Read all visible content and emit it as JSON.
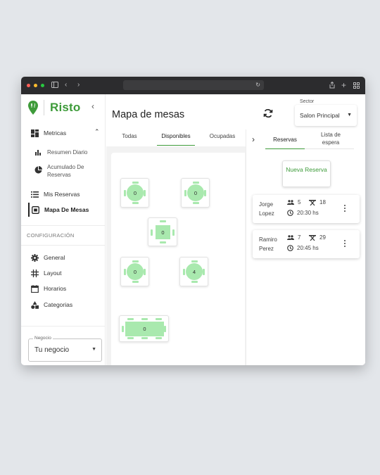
{
  "browser": {
    "colors": {
      "close": "#ff5f57",
      "minimize": "#febc2e",
      "zoom": "#28c840"
    }
  },
  "sidebar": {
    "brand": "Risto",
    "collapse_icon": "chevron-left-icon",
    "metricas": {
      "label": "Metricas",
      "items": [
        {
          "label": "Resumen Diario"
        },
        {
          "label": "Acumulado De Reservas"
        }
      ]
    },
    "nav": [
      {
        "label": "Mis Reservas"
      },
      {
        "label": "Mapa De Mesas",
        "active": true
      }
    ],
    "config_title": "CONFIGURACIÓN",
    "config_items": [
      {
        "label": "General",
        "icon": "gear-icon"
      },
      {
        "label": "Layout",
        "icon": "grid-icon"
      },
      {
        "label": "Horarios",
        "icon": "calendar-icon"
      },
      {
        "label": "Categorias",
        "icon": "shapes-icon"
      }
    ],
    "negocio": {
      "label": "Negocio",
      "value": "Tu negocio"
    }
  },
  "main": {
    "title": "Mapa de mesas",
    "sector": {
      "label": "Sector",
      "value": "Salon Principal"
    },
    "map_tabs": [
      "Todas",
      "Disponibles",
      "Ocupadas"
    ],
    "active_map_tab": "Disponibles",
    "tables": [
      {
        "count": "0",
        "shape": "round"
      },
      {
        "count": "0",
        "shape": "round"
      },
      {
        "count": "0",
        "shape": "square"
      },
      {
        "count": "0",
        "shape": "round"
      },
      {
        "count": "4",
        "shape": "round"
      },
      {
        "count": "0",
        "shape": "rect"
      }
    ]
  },
  "reservations": {
    "tabs": [
      "Reservas",
      "Lista de espera"
    ],
    "active_tab": "Reservas",
    "new_button": "Nueva Reserva",
    "cards": [
      {
        "name": "Jorge Lopez",
        "guests": "5",
        "table": "18",
        "time": "20:30 hs"
      },
      {
        "name": "Ramiro Perez",
        "guests": "7",
        "table": "29",
        "time": "20:45 hs"
      }
    ]
  },
  "accent": "#3e9b3a",
  "table_color": "#a9e9ae"
}
